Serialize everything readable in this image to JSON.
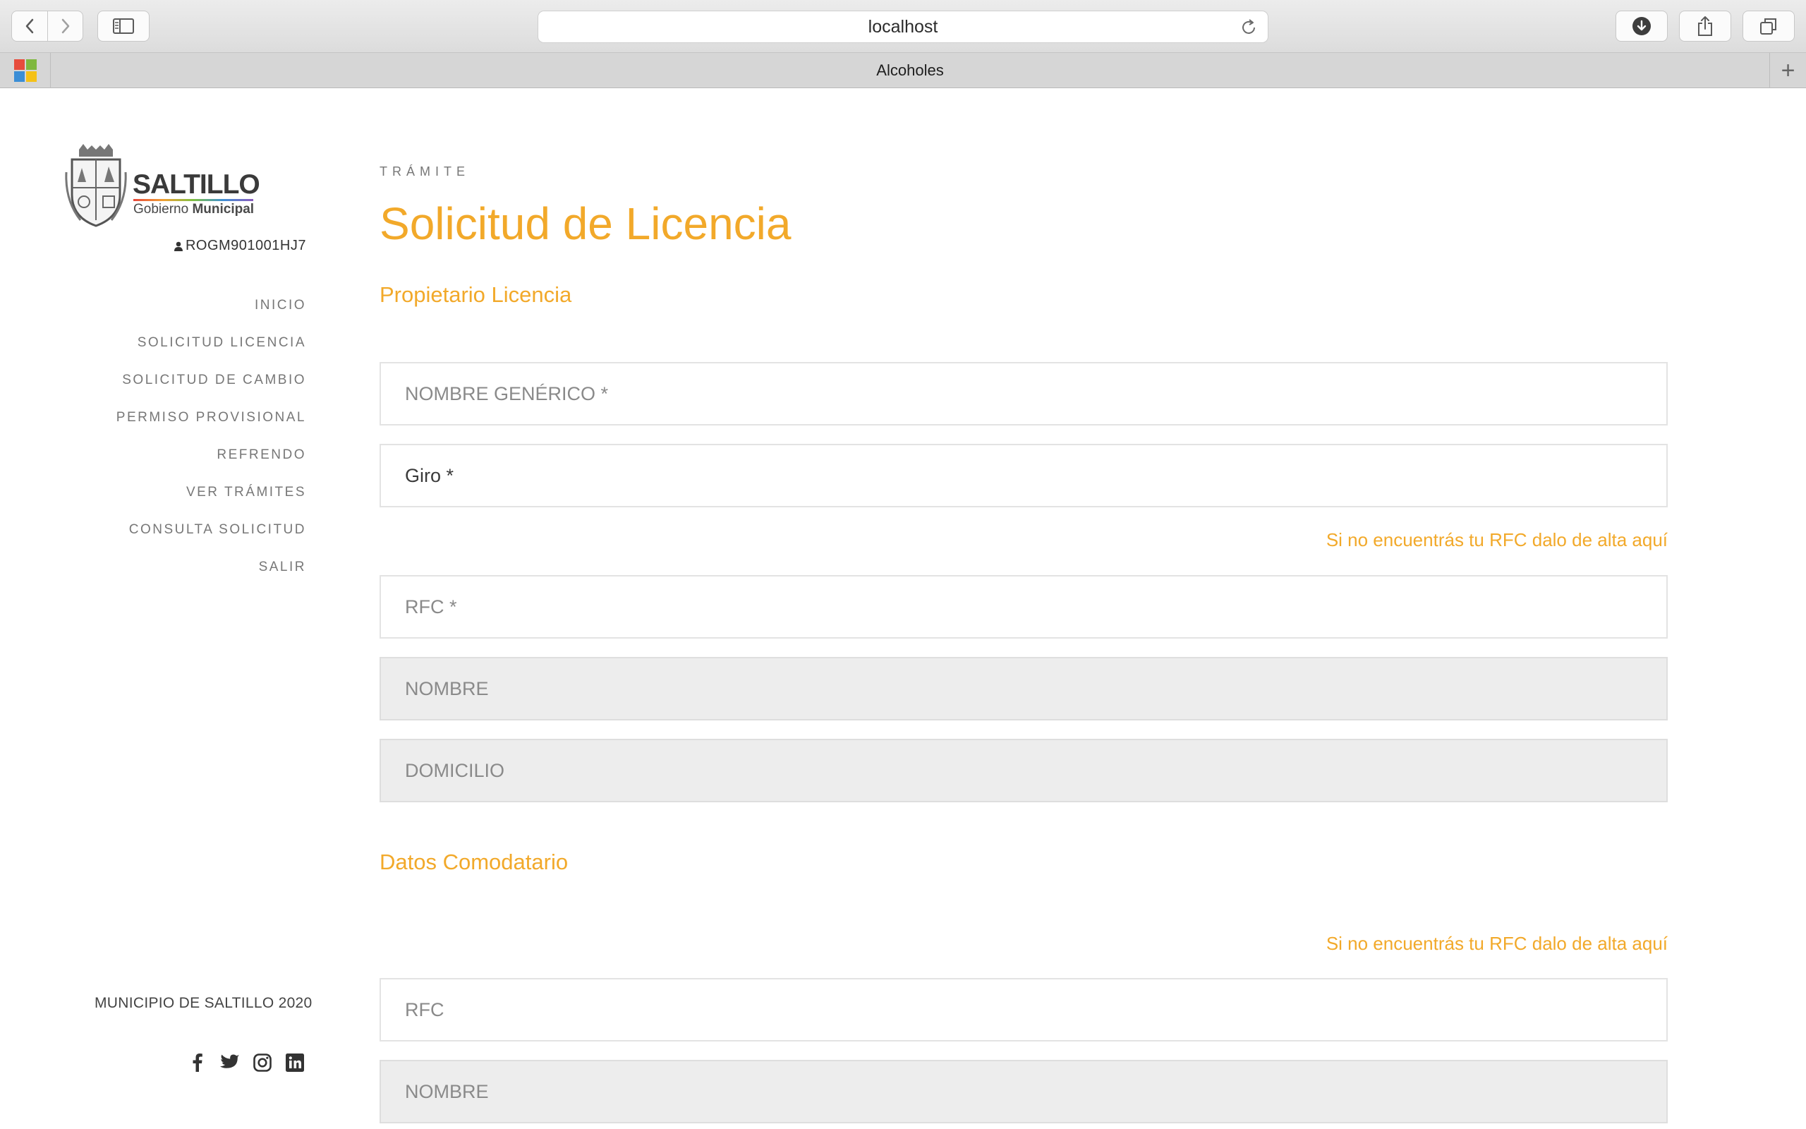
{
  "browser": {
    "url": "localhost",
    "tab_title": "Alcoholes",
    "new_tab_label": "+"
  },
  "sidebar": {
    "logo": {
      "name": "SALTILLO",
      "subtitle_light": "Gobierno",
      "subtitle_bold": "Municipal"
    },
    "user_id": "ROGM901001HJ7",
    "nav": [
      {
        "label": "INICIO"
      },
      {
        "label": "SOLICITUD LICENCIA"
      },
      {
        "label": "SOLICITUD DE CAMBIO"
      },
      {
        "label": "PERMISO PROVISIONAL"
      },
      {
        "label": "REFRENDO"
      },
      {
        "label": "VER TRÁMITES"
      },
      {
        "label": "CONSULTA SOLICITUD"
      },
      {
        "label": "SALIR"
      }
    ],
    "footer": "MUNICIPIO DE SALTILLO 2020",
    "social": [
      "facebook-icon",
      "twitter-icon",
      "instagram-icon",
      "linkedin-icon"
    ]
  },
  "main": {
    "kicker": "TRÁMITE",
    "title": "Solicitud de Licencia",
    "section_owner": "Propietario Licencia",
    "section_comodatario": "Datos Comodatario",
    "rfc_link": "Si no encuentrás tu RFC dalo de alta aquí",
    "fields": {
      "nombre_generico": "NOMBRE GENÉRICO *",
      "giro": "Giro *",
      "rfc_owner": "RFC *",
      "nombre_owner": "NOMBRE",
      "domicilio_owner": "DOMICILIO",
      "rfc_comodatario": "RFC",
      "nombre_comodatario": "NOMBRE"
    }
  },
  "colors": {
    "accent": "#f2a92a",
    "readonly_bg": "#ededed",
    "border": "#e3e3e3"
  }
}
